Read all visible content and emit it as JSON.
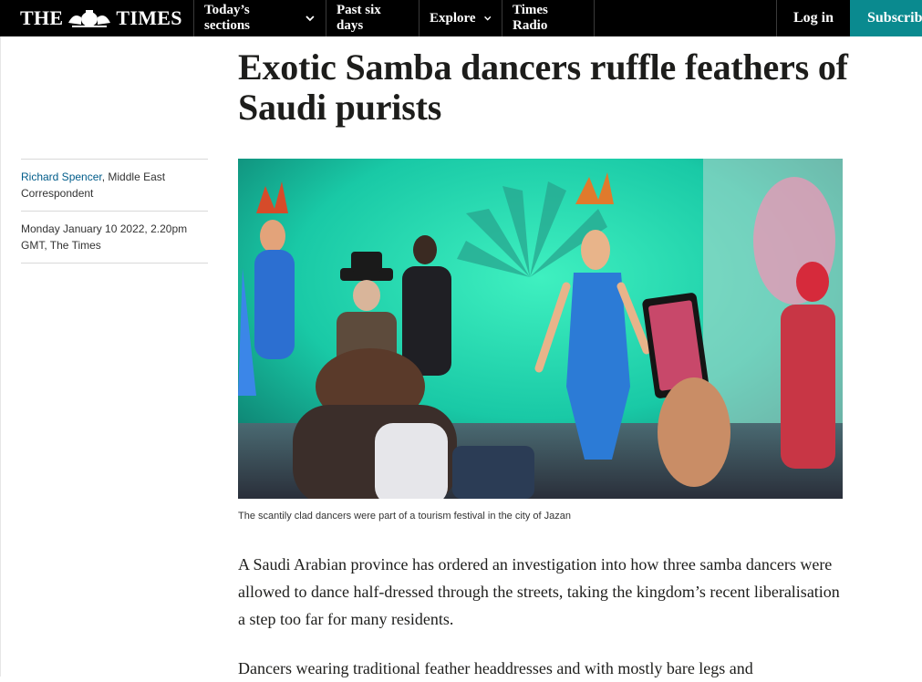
{
  "nav": {
    "logo_left": "THE",
    "logo_right": "TIMES",
    "items": [
      {
        "label": "Today’s sections",
        "dropdown": true
      },
      {
        "label": "Past six days",
        "dropdown": false
      },
      {
        "label": "Explore",
        "dropdown": true
      },
      {
        "label": "Times Radio",
        "dropdown": false
      }
    ],
    "login_label": "Log in",
    "subscribe_label": "Subscribe",
    "subscribe_color": "#0a8a8f"
  },
  "article": {
    "headline": "Exotic Samba dancers ruffle feathers of Saudi purists",
    "author": "Richard Spencer",
    "author_role": ", Middle East Correspondent",
    "dateline": "Monday January 10 2022, 2.20pm GMT, The Times",
    "image_caption": "The scantily clad dancers were part of a tourism festival in the city of Jazan",
    "paragraphs": [
      "A Saudi Arabian province has ordered an investigation into how three samba dancers were allowed to dance half-dressed through the streets, taking the kingdom’s recent liberalisation a step too far for many residents.",
      "Dancers wearing traditional feather headdresses and with mostly bare legs and"
    ]
  }
}
